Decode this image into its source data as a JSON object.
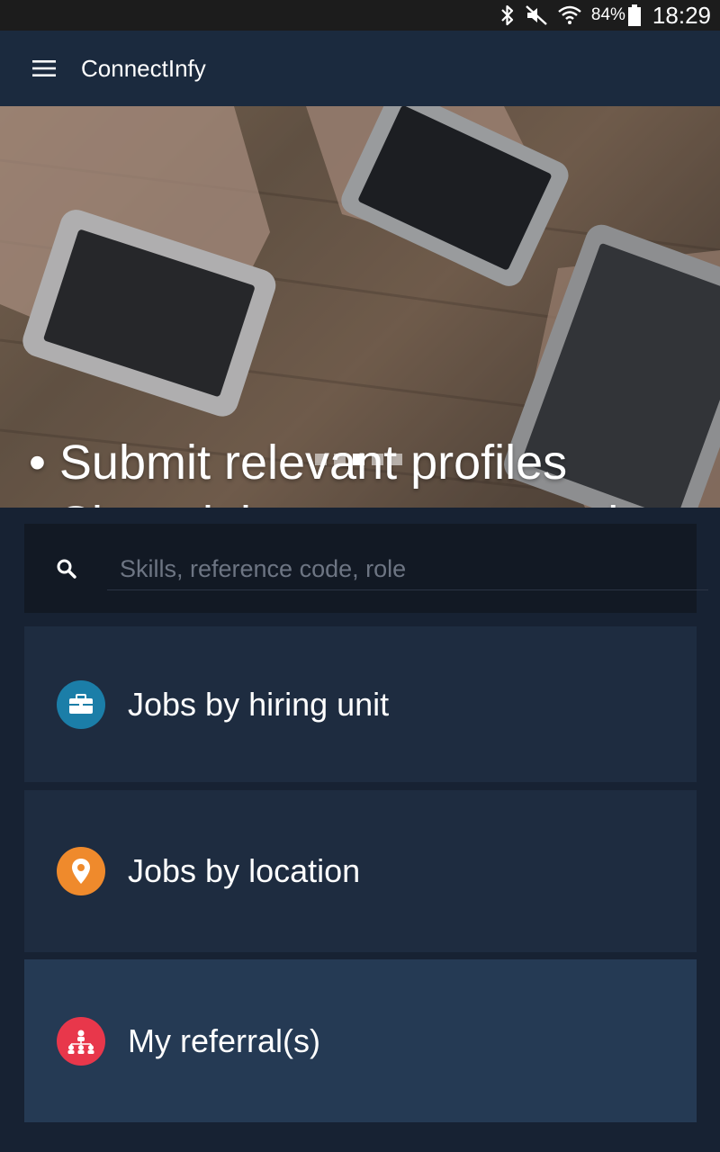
{
  "status_bar": {
    "battery_percent": "84%",
    "time": "18:29",
    "icons": [
      "bluetooth-icon",
      "mute-icon",
      "wifi-icon",
      "battery-icon"
    ]
  },
  "app_bar": {
    "title": "ConnectInfy",
    "menu_icon": "hamburger-menu-icon"
  },
  "hero": {
    "lines": [
      "• Submit relevant profiles",
      "• Share jobs across network"
    ],
    "pager": {
      "total": 5,
      "active_index": 2
    }
  },
  "search": {
    "placeholder": "Skills, reference code, role",
    "value": ""
  },
  "menu": [
    {
      "label": "Jobs by hiring unit",
      "icon": "briefcase-icon",
      "color": "#1b7ea8"
    },
    {
      "label": "Jobs by location",
      "icon": "location-pin-icon",
      "color": "#ef8a2c"
    },
    {
      "label": "My referral(s)",
      "icon": "referral-network-icon",
      "color": "#e8374b"
    }
  ]
}
